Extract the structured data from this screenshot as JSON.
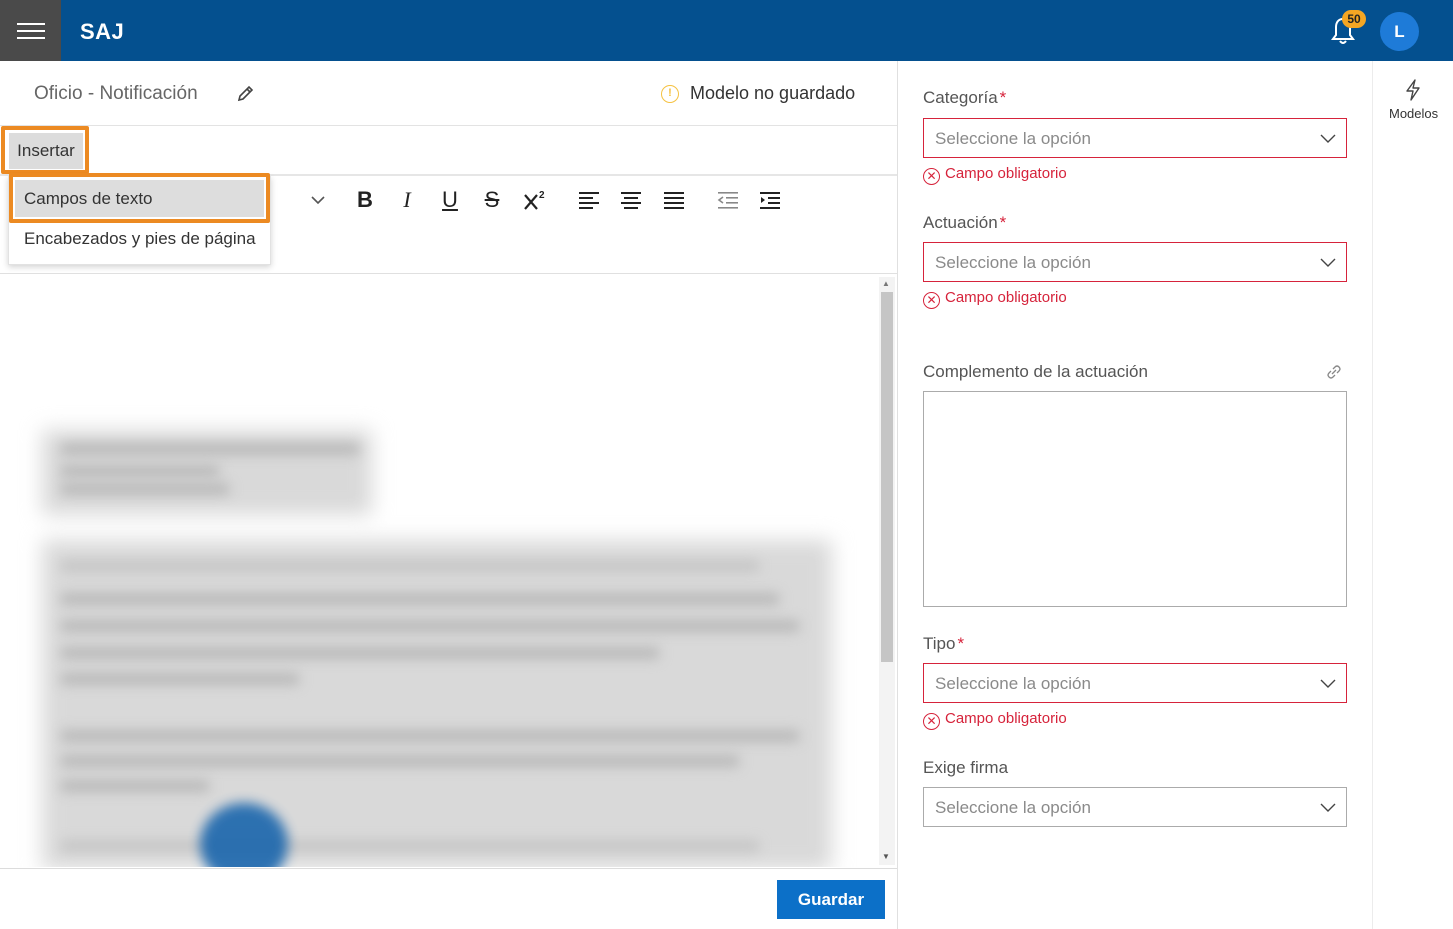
{
  "app": {
    "brand": "SAJ",
    "notifications_count": "50",
    "user_initial": "L"
  },
  "document": {
    "title": "Oficio - Notificación",
    "status": "Modelo no guardado"
  },
  "menu": {
    "insertar": "Insertar"
  },
  "dropdown": {
    "items": [
      "Campos de texto",
      "Encabezados y pies de página"
    ]
  },
  "toolbar": {
    "bold": "B",
    "italic": "I",
    "underline": "U",
    "strike": "S"
  },
  "footer": {
    "save_label": "Guardar"
  },
  "form": {
    "categoria": {
      "label": "Categoría",
      "placeholder": "Seleccione la opción",
      "error": "Campo obligatorio"
    },
    "actuacion": {
      "label": "Actuación",
      "placeholder": "Seleccione la opción",
      "error": "Campo obligatorio"
    },
    "complemento": {
      "label": "Complemento de la actuación",
      "value": ""
    },
    "tipo": {
      "label": "Tipo",
      "placeholder": "Seleccione la opción",
      "error": "Campo obligatorio"
    },
    "exige_firma": {
      "label": "Exige firma",
      "placeholder": "Seleccione la opción"
    },
    "required_mark": "*"
  },
  "side": {
    "models_label": "Modelos"
  },
  "colors": {
    "brand_bar": "#04508f",
    "highlight": "#ec8a22",
    "error": "#d6233b",
    "primary_button": "#0c70c8",
    "badge": "#f5a623"
  }
}
